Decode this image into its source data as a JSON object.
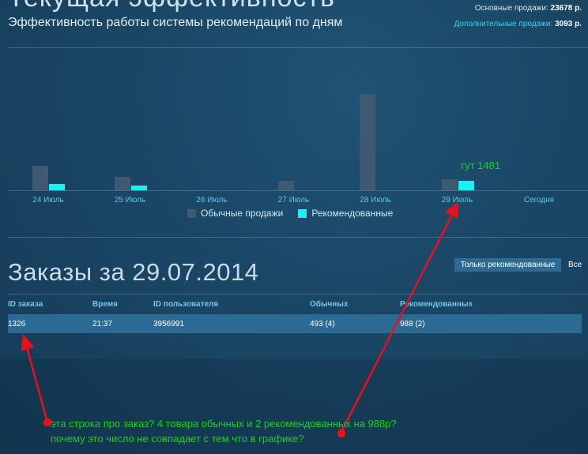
{
  "header": {
    "page_title": "Текущая эффективность",
    "subtitle": "Эффективность работы системы рекомендаций по дням",
    "main_sales_label": "Основные продажи: ",
    "main_sales_value": "23678 р.",
    "extra_sales_label": "Дополнительные продажи: ",
    "extra_sales_value": "3093 р."
  },
  "chart_data": {
    "type": "bar",
    "categories": [
      "24 Июль",
      "25 Июль",
      "26 Июль",
      "27 Июль",
      "28 Июль",
      "29 Июль",
      "Сегодня"
    ],
    "series": [
      {
        "name": "Обычные продажи",
        "values": [
          31,
          17,
          0,
          12,
          122,
          14,
          0
        ],
        "color": "#3f5a70"
      },
      {
        "name": "Рекомендованные",
        "values": [
          8,
          6,
          0,
          0,
          0,
          12,
          0
        ],
        "color": "#17f3f5"
      }
    ],
    "title": "",
    "xlabel": "",
    "ylabel": "",
    "legend": "bottom"
  },
  "annotation": {
    "bar_note": "тут 1481",
    "comment_line1": "эта строка про заказ? 4 товара обычных и 2 рекомендованных на 988р?",
    "comment_line2": "почему это число не совпадает с тем что в графике?",
    "color": "#12d414",
    "arrow_color": "#e8101a"
  },
  "orders": {
    "title": "Заказы за 29.07.2014",
    "filter_recommended": "Только рекомендованные",
    "filter_all": "Все",
    "columns": [
      "ID заказа",
      "Время",
      "ID пользователя",
      "Обычных",
      "Рекомендованных"
    ],
    "rows": [
      [
        "1326",
        "21:37",
        "3956991",
        "493 (4)",
        "988 (2)"
      ]
    ]
  }
}
